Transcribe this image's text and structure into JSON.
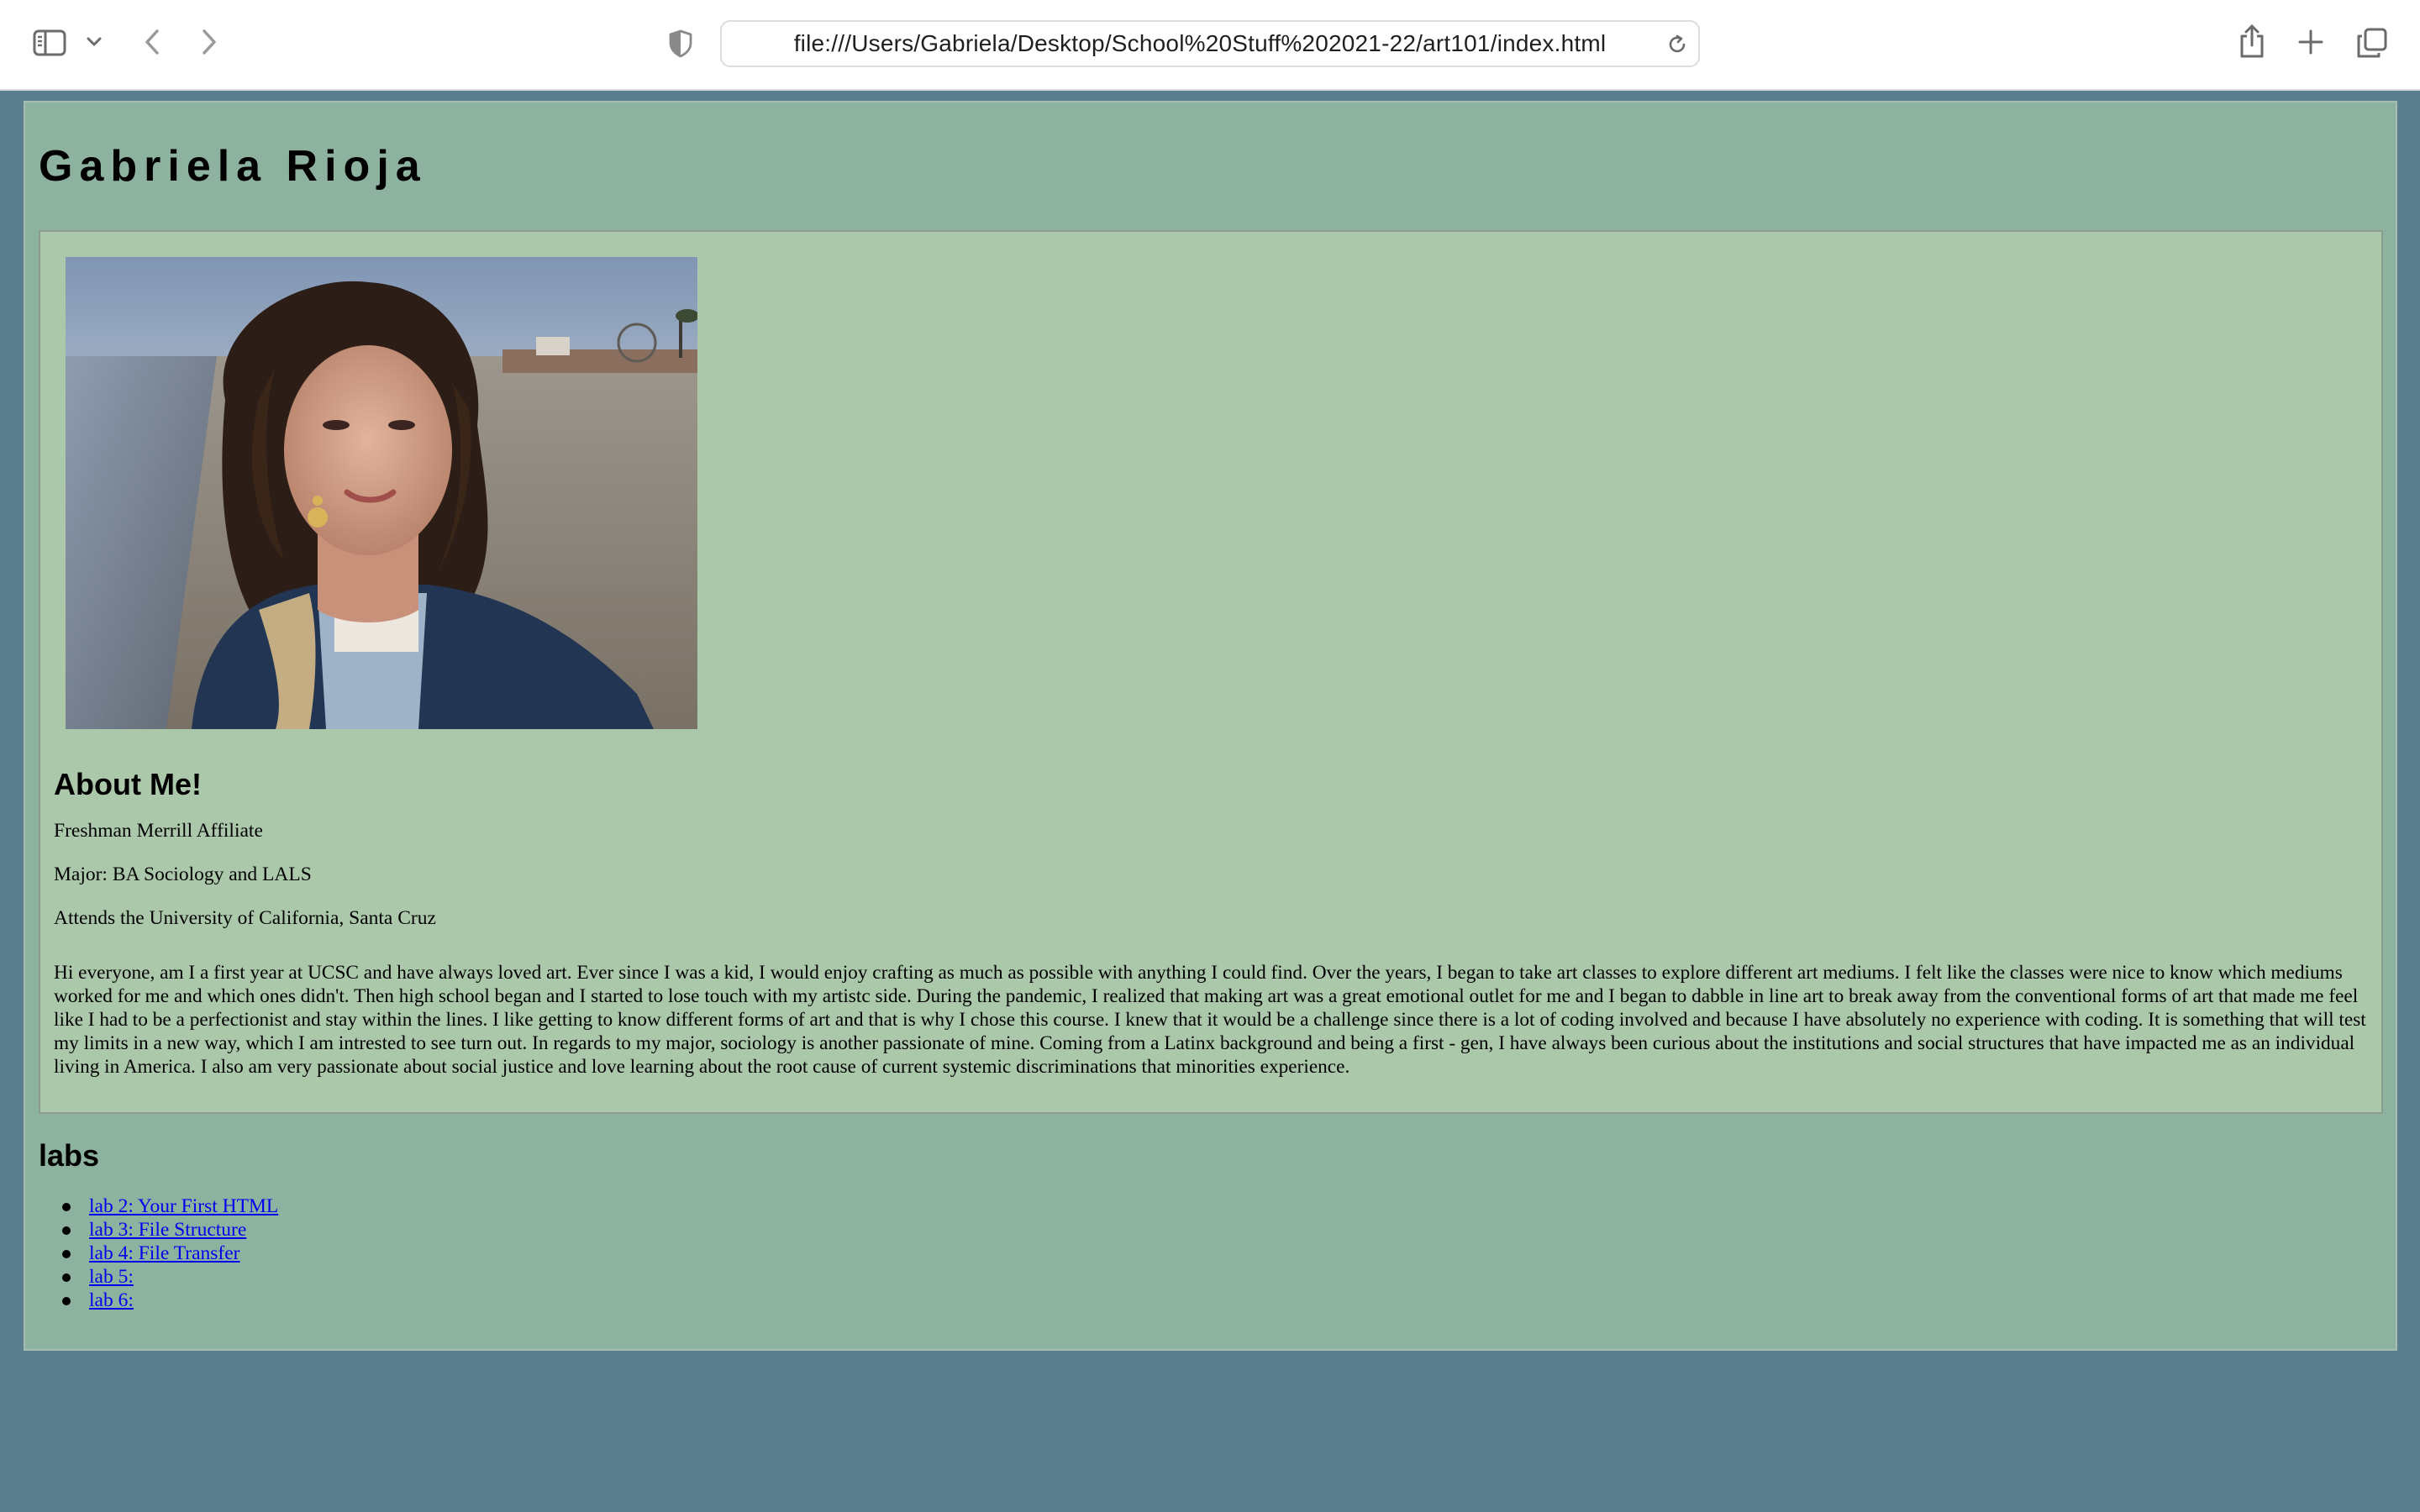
{
  "browser": {
    "url": "file:///Users/Gabriela/Desktop/School%20Stuff%202021-22/art101/index.html",
    "icons": {
      "sidebar": "sidebar-icon",
      "sidebar_menu": "chevron-down-icon",
      "back": "back-arrow-icon",
      "forward": "forward-arrow-icon",
      "privacy": "shield-icon",
      "reload": "reload-icon",
      "share": "share-icon",
      "new_tab": "plus-icon",
      "tabs": "tab-overview-icon"
    }
  },
  "page": {
    "title": "Gabriela Rioja",
    "photo": "portrait photo on a beach",
    "about": {
      "heading": "About Me!",
      "lines": [
        "Freshman Merrill Affiliate",
        "Major: BA Sociology and LALS",
        "Attends the University of California, Santa Cruz"
      ],
      "bio": "Hi everyone, am I a first year at UCSC and have always loved art. Ever since I was a kid, I would enjoy crafting as much as possible with anything I could find. Over the years, I began to take art classes to explore different art mediums. I felt like the classes were nice to know which mediums worked for me and which ones didn't. Then high school began and I started to lose touch with my artistc side. During the pandemic, I realized that making art was a great emotional outlet for me and I began to dabble in line art to break away from the conventional forms of art that made me feel like I had to be a perfectionist and stay within the lines. I like getting to know different forms of art and that is why I chose this course. I knew that it would be a challenge since there is a lot of coding involved and because I have absolutely no experience with coding. It is something that will test my limits in a new way, which I am intrested to see turn out. In regards to my major, sociology is another passionate of mine. Coming from a Latinx background and being a first - gen, I have always been curious about the institutions and social structures that have impacted me as an individual living in America. I also am very passionate about social justice and love learning about the root cause of current systemic discriminations that minorities experience."
    },
    "labs": {
      "heading": "labs",
      "items": [
        "lab 2: Your First HTML",
        "lab 3: File Structure",
        "lab 4: File Transfer",
        "lab 5:",
        "lab 6:"
      ]
    }
  },
  "colors": {
    "page_background": "#5b7e8f",
    "outer_box": "#8db2a0",
    "about_box": "#abc8ab",
    "link": "#0000ee"
  }
}
